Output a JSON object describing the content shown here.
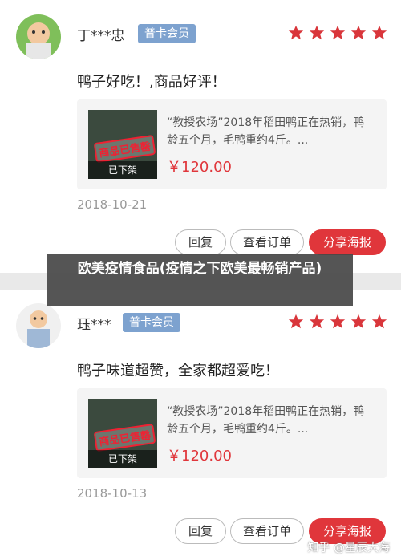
{
  "reviews": [
    {
      "username": "丁***忠",
      "badge": "普卡会员",
      "rating": 5,
      "comment": "鸭子好吃！,商品好评！",
      "product": {
        "description": "“教授农场”2018年稻田鸭正在热销，鸭龄五个月，毛鸭重约4斤。...",
        "price": "￥120.00",
        "status": "已下架",
        "stamp": "商品已售罄"
      },
      "date": "2018-10-21",
      "buttons": {
        "reply": "回复",
        "view_order": "查看订单",
        "share": "分享海报"
      }
    },
    {
      "username": "珏***",
      "badge": "普卡会员",
      "rating": 5,
      "comment": "鸭子味道超赞，全家都超爱吃！",
      "product": {
        "description": "“教授农场”2018年稻田鸭正在热销，鸭龄五个月，毛鸭重约4斤。...",
        "price": "￥120.00",
        "status": "已下架",
        "stamp": "商品已售罄"
      },
      "date": "2018-10-13",
      "buttons": {
        "reply": "回复",
        "view_order": "查看订单",
        "share": "分享海报"
      }
    }
  ],
  "caption": "欧美疫情食品(疫情之下欧美最畅销产品)",
  "watermark": "知乎 @星辰大海",
  "colors": {
    "accent": "#e0363b",
    "badge": "#7da2cf",
    "star": "#d9363b"
  }
}
